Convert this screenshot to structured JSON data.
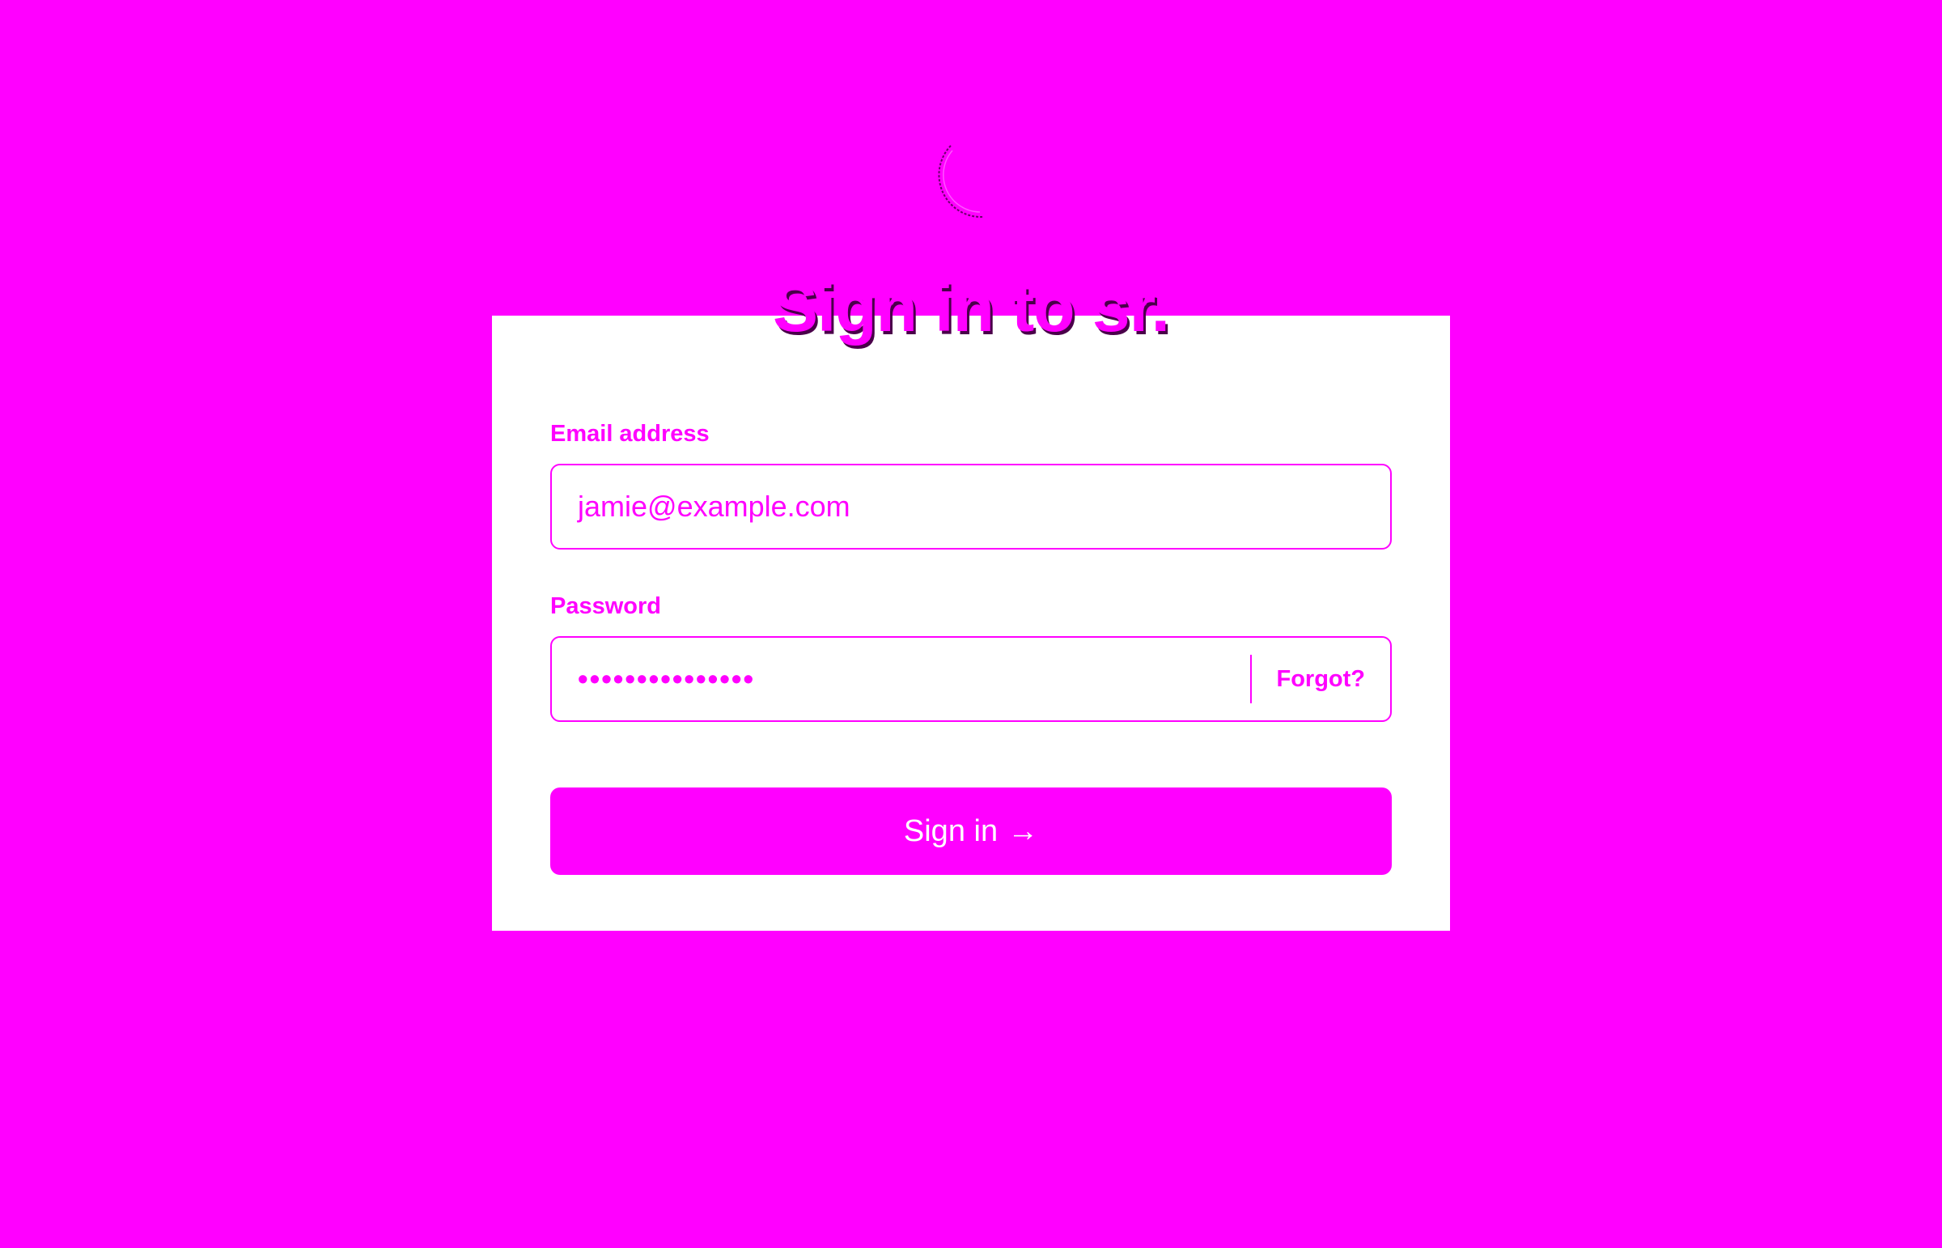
{
  "brand": {
    "logo_icon": "circle-arc-logo-icon",
    "title": "Sign in to sr."
  },
  "form": {
    "email": {
      "label": "Email address",
      "value": "jamie@example.com"
    },
    "password": {
      "label": "Password",
      "masked_value": "•••••••••••••••",
      "forgot_label": "Forgot?"
    },
    "submit": {
      "label": "Sign in",
      "icon": "arrow-right-icon",
      "arrow_glyph": "→"
    }
  },
  "colors": {
    "background": "#ff00ff",
    "card": "#ffffff",
    "accent": "#ff00ff",
    "title_shadow": "#4a004a"
  }
}
